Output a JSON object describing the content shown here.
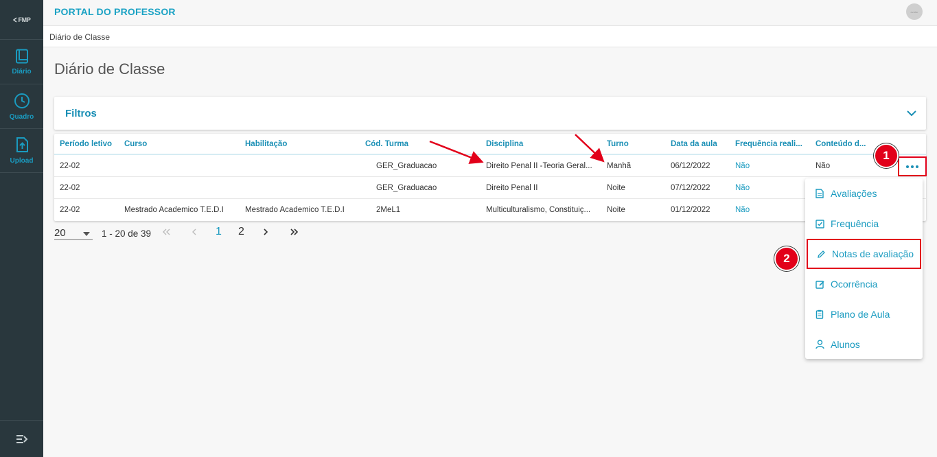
{
  "app": {
    "logo_text": "FMP",
    "portal_title": "PORTAL DO PROFESSOR",
    "avatar_text": "avatar"
  },
  "sidebar": {
    "items": [
      {
        "label": "Diário",
        "icon": "book-icon"
      },
      {
        "label": "Quadro",
        "icon": "clock-icon"
      },
      {
        "label": "Upload",
        "icon": "upload-icon"
      }
    ],
    "bottom_icon": "menu-collapse-icon"
  },
  "breadcrumb": "Diário de Classe",
  "page_title": "Diário de Classe",
  "filters": {
    "title": "Filtros",
    "icon": "chevron-down-icon"
  },
  "table": {
    "headers": [
      "Período letivo",
      "Curso",
      "Habilitação",
      "Cód. Turma",
      "Disciplina",
      "Turno",
      "Data da aula",
      "Frequência reali...",
      "Conteúdo d..."
    ],
    "rows": [
      [
        "22-02",
        "",
        "",
        "GER_Graduacao",
        "Direito Penal II -Teoria Geral...",
        "Manhã",
        "06/12/2022",
        "Não",
        "Não"
      ],
      [
        "22-02",
        "",
        "",
        "GER_Graduacao",
        "Direito Penal II",
        "Noite",
        "07/12/2022",
        "Não",
        ""
      ],
      [
        "22-02",
        "Mestrado Academico T.E.D.I",
        "Mestrado Academico T.E.D.I",
        "2MeL1",
        "Multiculturalismo, Constituiç...",
        "Noite",
        "01/12/2022",
        "Não",
        ""
      ]
    ],
    "more_icon": "ellipsis-icon"
  },
  "pagination": {
    "page_size": "20",
    "range": "1 - 20 de 39",
    "pages": [
      "1",
      "2"
    ],
    "current_page": "1"
  },
  "menu": {
    "items": [
      {
        "label": "Avaliações",
        "icon": "document-icon"
      },
      {
        "label": "Frequência",
        "icon": "checkbox-icon"
      },
      {
        "label": "Notas de avaliação",
        "icon": "pencil-icon"
      },
      {
        "label": "Ocorrência",
        "icon": "edit-note-icon"
      },
      {
        "label": "Plano de Aula",
        "icon": "clipboard-icon"
      },
      {
        "label": "Alunos",
        "icon": "user-icon"
      }
    ]
  },
  "annotations": {
    "badge_1": "1",
    "badge_2": "2",
    "color": "#e2001a"
  },
  "colors": {
    "accent": "#1a9bc0",
    "sidebar_bg": "#29373d",
    "highlight": "#e2001a"
  }
}
